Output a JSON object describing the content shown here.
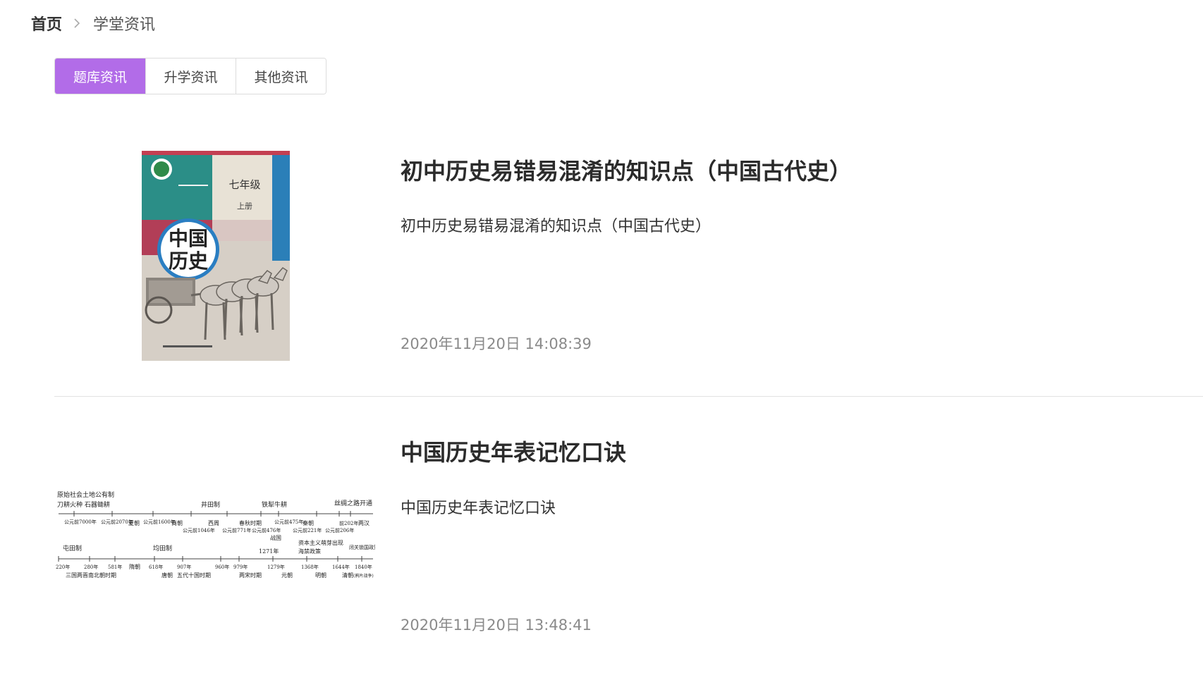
{
  "breadcrumb": {
    "home": "首页",
    "current": "学堂资讯",
    "separator_icon": "chevron-right-icon"
  },
  "tabs": [
    {
      "label": "题库资讯",
      "active": true
    },
    {
      "label": "升学资讯",
      "active": false
    },
    {
      "label": "其他资讯",
      "active": false
    }
  ],
  "accent_color": "#b26ce8",
  "articles": [
    {
      "title": "初中历史易错易混淆的知识点（中国古代史）",
      "summary": "初中历史易错易混淆的知识点（中国古代史）",
      "date": "2020年11月20日 14:08:39",
      "thumbnail": {
        "kind": "textbook-cover",
        "grade": "七年级",
        "volume": "上册",
        "subject_line1": "中国",
        "subject_line2": "历史"
      }
    },
    {
      "title": "中国历史年表记忆口诀",
      "summary": "中国历史年表记忆口诀",
      "date": "2020年11月20日 13:48:41",
      "thumbnail": {
        "kind": "timeline",
        "row1_top": [
          "原始社会土地公有制",
          "刀耕火种  石器锄耕",
          "井田制",
          "铁犁牛耕",
          "丝绸之路开通"
        ],
        "row1_bottom": [
          "公元前7000年",
          "公元前2070年",
          "夏朝",
          "公元前1600年",
          "商朝",
          "公元前1046年",
          "西周",
          "公元前771年",
          "春秋时期",
          "公元前476年",
          "公元前475年",
          "战国",
          "公元前221年",
          "秦朝",
          "公元前206年",
          "前202年",
          "两汉"
        ],
        "row2_top": [
          "屯田制",
          "均田制",
          "1271年",
          "资本主义萌芽出现",
          "海禁政策",
          "闭关锁国政策"
        ],
        "row2_bottom": [
          "220年",
          "三国两晋南北朝时期",
          "280年",
          "581年",
          "隋朝",
          "618年",
          "唐朝",
          "907年",
          "五代十国时期",
          "960年",
          "979年",
          "两宋时期",
          "1279年",
          "元朝",
          "1368年",
          "明朝",
          "1644年",
          "清朝",
          "1840年",
          "(鸦片战争)"
        ]
      }
    }
  ]
}
